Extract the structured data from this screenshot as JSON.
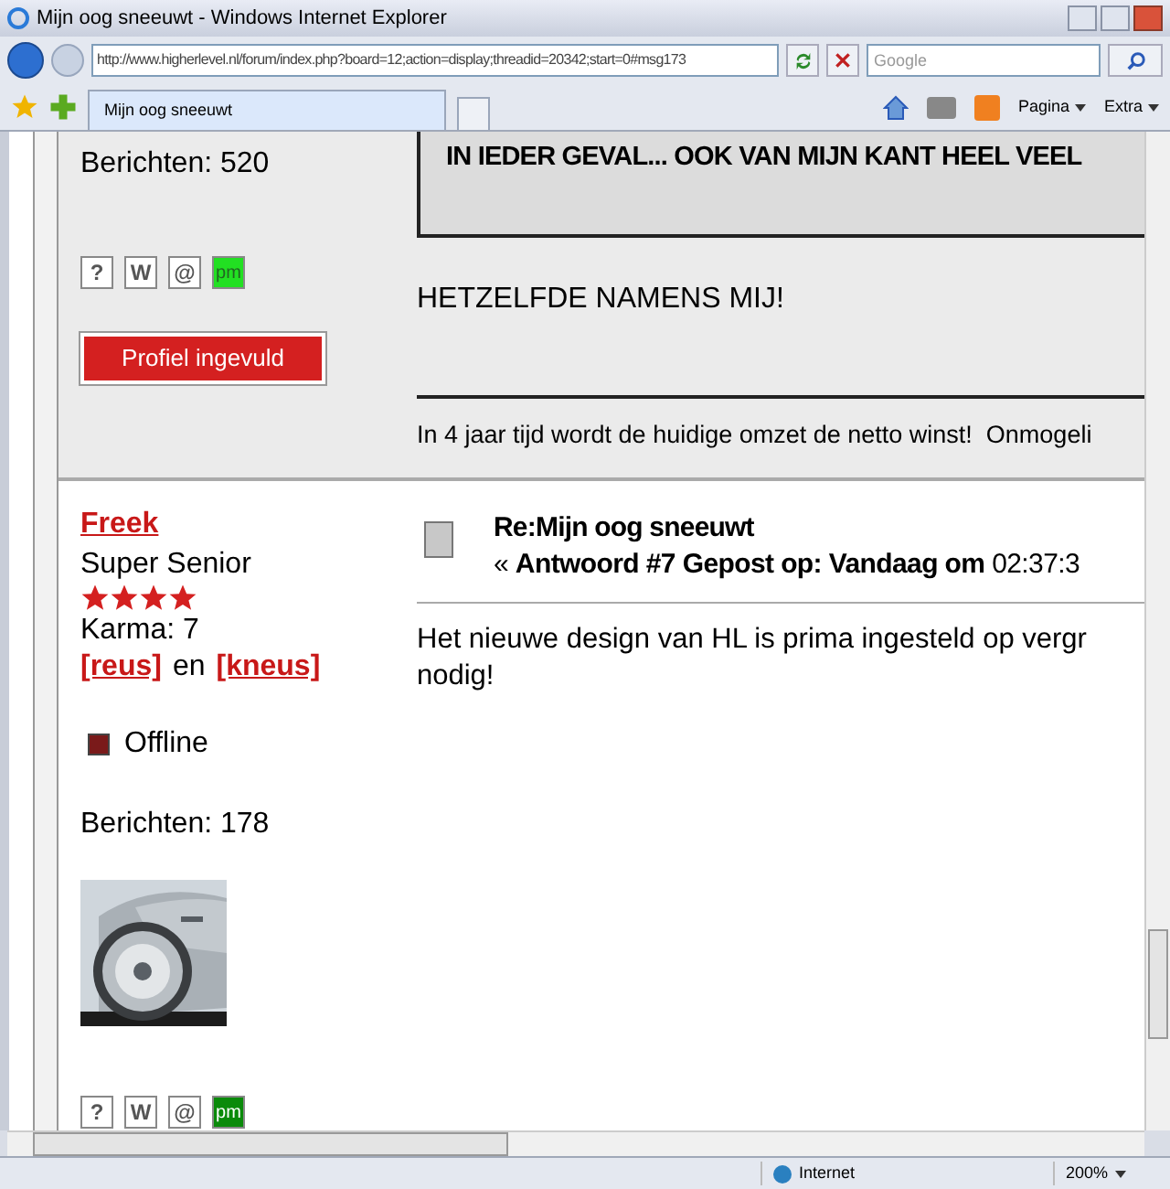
{
  "window": {
    "title": "Mijn oog sneeuwt - Windows Internet Explorer"
  },
  "address_bar": {
    "url": "http://www.higherlevel.nl/forum/index.php?board=12;action=display;threadid=20342;start=0#msg173",
    "search_placeholder": "Google"
  },
  "tabs": [
    {
      "label": "Mijn oog sneeuwt",
      "selected": true
    }
  ],
  "toolbar": {
    "page_label": "Pagina",
    "tools_label": "Extra"
  },
  "posts": [
    {
      "profile": {
        "posts_count": "Berichten: 520",
        "buttons": [
          {
            "label": "?"
          },
          {
            "label": "W"
          },
          {
            "label": "@"
          },
          {
            "label": "pm",
            "color": "#22e022"
          }
        ],
        "badge": "Profiel ingevuld"
      },
      "quote": "IN IEDER GEVAL... OOK VAN MIJN KANT HEEL VEEL",
      "body": [
        "HETZELFDE NAMENS MIJ!"
      ],
      "signature": "In 4 jaar tijd wordt de huidige omzet de netto winst!  Onmogeli",
      "shaded": true
    },
    {
      "profile": {
        "name": "Freek",
        "rank": "Super Senior",
        "stars": 4,
        "karma": "Karma: 7",
        "karma_up": "[reus]",
        "karma_joiner": "en",
        "karma_down": "[kneus]",
        "online": false,
        "status_label": "Offline",
        "posts_count": "Berichten: 178",
        "buttons": [
          {
            "label": "?"
          },
          {
            "label": "W"
          },
          {
            "label": "@"
          },
          {
            "label": "pm",
            "color": "#0a8a0a"
          }
        ]
      },
      "title": "Re:Mijn oog sneeuwt",
      "meta": "« **Antwoord #7 Gepost op: Vandaag om** 02:37:3",
      "body": [
        "Het nieuwe design van HL is prima ingesteld op vergr",
        "nodig!"
      ],
      "shaded": false
    }
  ],
  "status_bar": {
    "zone": "Internet",
    "zoom": "200%"
  }
}
